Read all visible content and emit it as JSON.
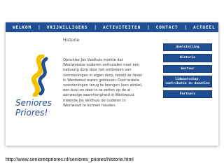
{
  "nav": {
    "items": [
      "WELKOM",
      "VRIJWILLIGERS",
      "ACTIVITEITEN",
      "CONTACT",
      "ACTUEEL"
    ]
  },
  "page": {
    "title": "Historie",
    "body": "Oprichter Jos Veldhuis merkte dat\nWestwoudse ouderen verhuisden naar een\nnabuurig dorp door het ontbreken van\nvoorzieningen in eigen dorp, terwijl ze liever\nin Westwoud waren gebleven. Door enkele\nvoorzieningen terug te brengen (een winkel,\neen bus) en door in te zetten op de al\naanwezige saamhorigheid in Westwoud,\nmeende Jos Veldhuis de ouderen in\nWestwoud te kunnen houden."
  },
  "logo": {
    "text": "Seniores Priores!"
  },
  "sidebar": {
    "buttons": [
      "doelstelling",
      "Historie",
      "bestuur",
      "lidmaatschap, contributie en donaties",
      "Partners"
    ]
  },
  "status": {
    "url": "http://www.seniorespriores.nl/seniores_priores/historie.html"
  },
  "colors": {
    "brand_blue": "#1f4f92",
    "logo_yellow": "#f2c200"
  }
}
